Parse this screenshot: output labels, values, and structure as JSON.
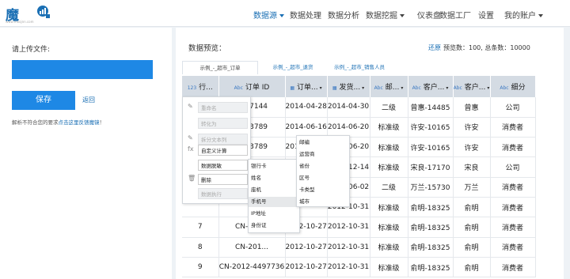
{
  "logo": {
    "text": "魔镜",
    "sub": "www.moojnn.com"
  },
  "nav": [
    {
      "label": "数据源",
      "dropdown": true,
      "active": true
    },
    {
      "label": "数据处理",
      "dropdown": false,
      "active": false
    },
    {
      "label": "数据分析",
      "dropdown": false,
      "active": false
    },
    {
      "label": "数据挖掘",
      "dropdown": true,
      "active": false
    },
    {
      "label": "仪表盘",
      "dropdown": false,
      "active": false
    },
    {
      "label": "数据工厂",
      "dropdown": false,
      "active": false
    },
    {
      "label": "设置",
      "dropdown": false,
      "active": false
    },
    {
      "label": "我的账户",
      "dropdown": true,
      "active": false
    }
  ],
  "upload": {
    "label": "请上传文件:"
  },
  "save_label": "保存",
  "back_label": "返回",
  "hint": {
    "text": "解析不符合您的要求",
    "link": "点击这里反馈魔镜",
    "end": "！"
  },
  "preview": {
    "label": "数据预览：",
    "restore": "还原",
    "count": "预览数：100, 总条数：10000"
  },
  "tabs": [
    "示例_-_超市_订单",
    "示例_-_超市_退货",
    "示例_-_超市_销售人员"
  ],
  "table": {
    "columns": [
      {
        "type": "123",
        "name": "行..."
      },
      {
        "type": "Abc",
        "name": "订单 ID"
      },
      {
        "type": "cal",
        "name": "订单..."
      },
      {
        "type": "cal",
        "name": "发货..."
      },
      {
        "type": "Abc",
        "name": "邮..."
      },
      {
        "type": "Abc",
        "name": "客户..."
      },
      {
        "type": "Abc",
        "name": "客户..."
      },
      {
        "type": "Abc",
        "name": "细分"
      }
    ],
    "rows": [
      [
        "",
        "1357144",
        "2014-04-28",
        "2014-04-30",
        "二级",
        "曾惠-14485",
        "曾惠",
        "公司"
      ],
      [
        "",
        "1973789",
        "2014-06-16",
        "2014-06-20",
        "标准级",
        "许安-10165",
        "许安",
        "消费者"
      ],
      [
        "",
        "1973789",
        "2014-06-16",
        "2014-06-20",
        "标准级",
        "许安-10165",
        "许安",
        "消费者"
      ],
      [
        "",
        "",
        "",
        "2014-12-14",
        "标准级",
        "宋良-17170",
        "宋良",
        "公司"
      ],
      [
        "",
        "",
        "",
        "2015-06-02",
        "二级",
        "万兰-15730",
        "万兰",
        "消费者"
      ],
      [
        "",
        "",
        "",
        "2012-10-31",
        "标准级",
        "俞明-18325",
        "俞明",
        "消费者"
      ],
      [
        "7",
        "CN-201...",
        "2012-10-27",
        "2012-10-31",
        "标准级",
        "俞明-18325",
        "俞明",
        "消费者"
      ],
      [
        "8",
        "CN-201...",
        "2012-10-27",
        "2012-10-31",
        "标准级",
        "俞明-18325",
        "俞明",
        "消费者"
      ],
      [
        "9",
        "CN-2012-4497736",
        "2012-10-27",
        "2012-10-31",
        "标准级",
        "俞明-18325",
        "俞明",
        "消费者"
      ]
    ]
  },
  "context_menu": [
    {
      "label": "重命名",
      "disabled": true,
      "icon": "✎"
    },
    {
      "label": "转化为",
      "disabled": true,
      "icon": ""
    },
    {
      "label": "拆分文本列",
      "disabled": true,
      "icon": "✎"
    },
    {
      "label": "自定义计算",
      "disabled": false,
      "icon": "fx"
    },
    {
      "label": "数据脱敏",
      "disabled": false,
      "icon": ""
    },
    {
      "label": "删除",
      "disabled": false,
      "icon": "🗑"
    },
    {
      "label": "数据执行",
      "disabled": true,
      "icon": ""
    }
  ],
  "submenu_mask": [
    "银行卡",
    "姓名",
    "座机",
    "手机号",
    "IP地址",
    "身份证"
  ],
  "submenu_region": [
    "邮编",
    "运营商",
    "省份",
    "区号",
    "卡类型",
    "城市"
  ]
}
